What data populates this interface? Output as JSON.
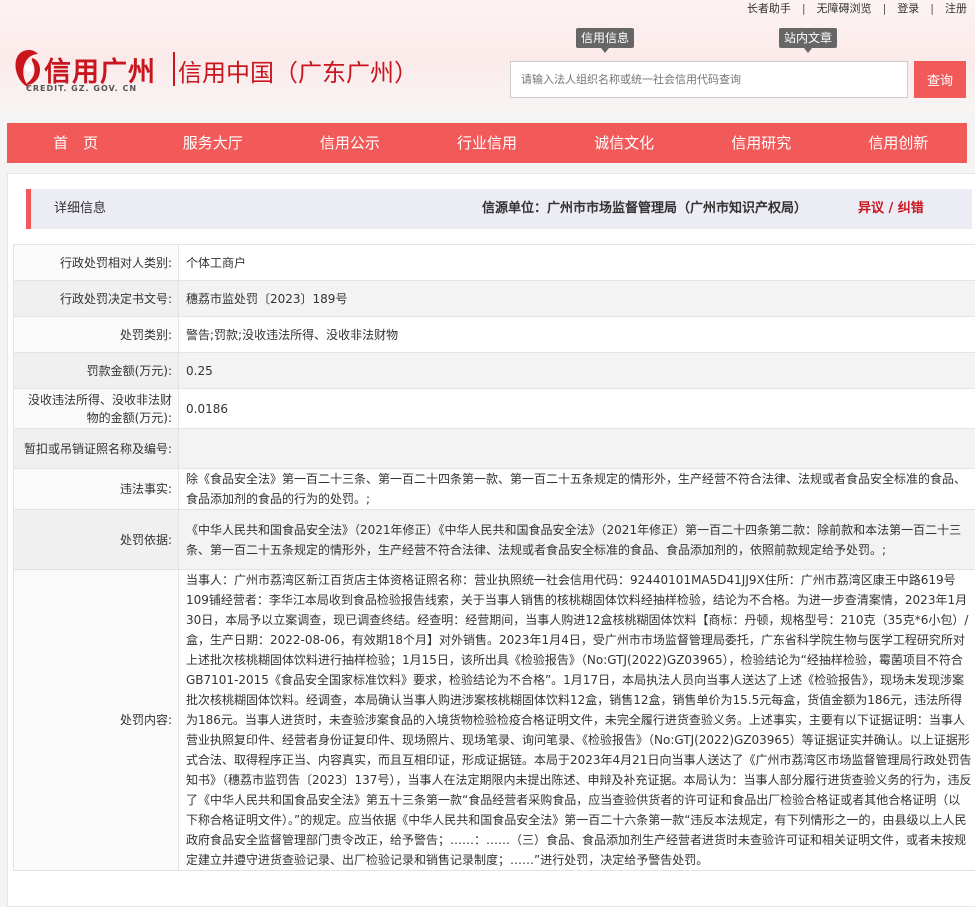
{
  "toplinks": [
    "长者助手",
    "无障碍浏览",
    "登录",
    "注册"
  ],
  "logo": {
    "cn": "信用广州",
    "cn2": "信用中国（广东广州）",
    "en": "CREDIT. GZ. GOV. CN"
  },
  "tags": {
    "info": "信用信息",
    "site": "站内文章"
  },
  "search": {
    "placeholder": "请输入法人组织名称或统一社会信用代码查询",
    "button": "查询"
  },
  "nav": [
    "首　页",
    "服务大厅",
    "信用公示",
    "行业信用",
    "诚信文化",
    "信用研究",
    "信用创新"
  ],
  "detail": {
    "title": "详细信息",
    "source": "信源单位：广州市市场监督管理局（广州市知识产权局）",
    "dispute": "异议 / 纠错"
  },
  "rows": [
    {
      "k": "行政处罚相对人类别:",
      "v": "个体工商户"
    },
    {
      "k": "行政处罚决定书文号:",
      "v": "穗荔市监处罚〔2023〕189号"
    },
    {
      "k": "处罚类别:",
      "v": "警告;罚款;没收违法所得、没收非法财物"
    },
    {
      "k": "罚款金额(万元):",
      "v": "0.25"
    },
    {
      "k": "没收违法所得、没收非法财物的金额(万元):",
      "v": "0.0186"
    },
    {
      "k": "暂扣或吊销证照名称及编号:",
      "v": ""
    },
    {
      "k": "违法事实:",
      "v": "除《食品安全法》第一百二十三条、第一百二十四条第一款、第一百二十五条规定的情形外，生产经营不符合法律、法规或者食品安全标准的食品、食品添加剂的食品的行为的处罚。;"
    },
    {
      "k": "处罚依据:",
      "v": "《中华人民共和国食品安全法》（2021年修正）《中华人民共和国食品安全法》（2021年修正）第一百二十四条第二款：除前款和本法第一百二十三条、第一百二十五条规定的情形外，生产经营不符合法律、法规或者食品安全标准的食品、食品添加剂的，依照前款规定给予处罚。;"
    },
    {
      "k": "处罚内容:",
      "v": "当事人：广州市荔湾区新江百货店主体资格证照名称：营业执照统一社会信用代码：92440101MA5D41JJ9X住所：广州市荔湾区康王中路619号109铺经营者：李华江本局收到食品检验报告线索，关于当事人销售的核桃糊固体饮料经抽样检验，结论为不合格。为进一步查清案情，2023年1月30日，本局予以立案调查，现已调查终结。经查明：经营期间，当事人购进12盒核桃糊固体饮料【商标：丹顿，规格型号：210克（35克*6小包）/盒，生产日期：2022-08-06，有效期18个月】对外销售。2023年1月4日，受广州市市场监督管理局委托，广东省科学院生物与医学工程研究所对上述批次核桃糊固体饮料进行抽样检验；1月15日，该所出具《检验报告》（No:GTJ(2022)GZ03965），检验结论为“经抽样检验，霉菌项目不符合GB7101-2015《食品安全国家标准饮料》要求，检验结论为不合格”。1月17日，本局执法人员向当事人送达了上述《检验报告》，现场未发现涉案批次核桃糊固体饮料。经调查，本局确认当事人购进涉案核桃糊固体饮料12盒，销售12盒，销售单价为15.5元每盒，货值金额为186元，违法所得为186元。当事人进货时，未查验涉案食品的入境货物检验检疫合格证明文件，未完全履行进货查验义务。上述事实，主要有以下证据证明：当事人营业执照复印件、经营者身份证复印件、现场照片、现场笔录、询问笔录、《检验报告》（No:GTJ(2022)GZ03965）等证据证实并确认。以上证据形式合法、取得程序正当、内容真实，而且互相印证，形成证据链。本局于2023年4月21日向当事人送达了《广州市荔湾区市场监督管理局行政处罚告知书》（穗荔市监罚告〔2023〕137号），当事人在法定期限内未提出陈述、申辩及补充证据。本局认为：当事人部分履行进货查验义务的行为，违反了《中华人民共和国食品安全法》第五十三条第一款“食品经营者采购食品，应当查验供货者的许可证和食品出厂检验合格证或者其他合格证明（以下称合格证明文件）。”的规定。应当依据《中华人民共和国食品安全法》第一百二十六条第一款“违反本法规定，有下列情形之一的，由县级以上人民政府食品安全监督管理部门责令改正，给予警告；……：……（三）食品、食品添加剂生产经营者进货时未查验许可证和相关证明文件，或者未按规定建立并遵守进货查验记录、出厂检验记录和销售记录制度；……”进行处罚，决定给予警告处罚。"
    }
  ]
}
